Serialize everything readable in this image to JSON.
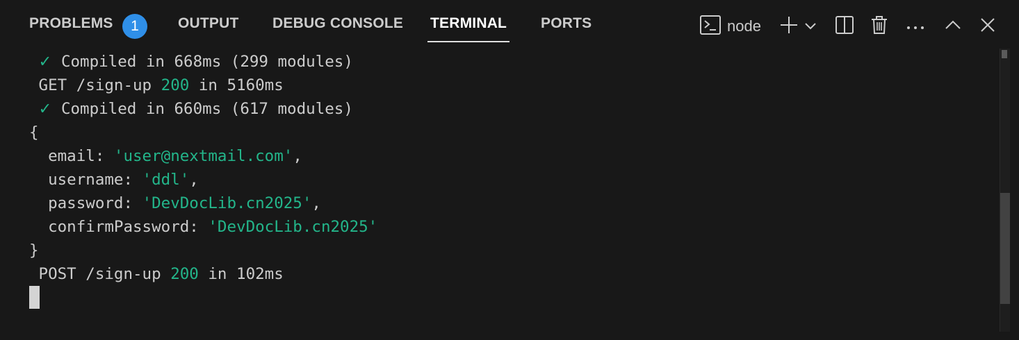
{
  "tabs": [
    {
      "label": "PROBLEMS",
      "badge": "1"
    },
    {
      "label": "OUTPUT"
    },
    {
      "label": "DEBUG CONSOLE"
    },
    {
      "label": "TERMINAL"
    },
    {
      "label": "PORTS"
    }
  ],
  "active_tab": "TERMINAL",
  "toolbar": {
    "terminal_name": "node",
    "icons": [
      "terminal-icon",
      "plus-icon",
      "chevron-down-icon",
      "split-editor-icon",
      "trash-icon",
      "more-icon",
      "chevron-up-icon",
      "close-icon"
    ]
  },
  "terminal": {
    "line1": {
      "check": "✓",
      "text": " Compiled in 668ms (299 modules)"
    },
    "line2": {
      "pre": " GET /sign-up ",
      "status": "200",
      "post": " in 5160ms"
    },
    "line3": {
      "check": "✓",
      "text": " Compiled in 660ms (617 modules)"
    },
    "line4": "{",
    "line5": {
      "key": "  email: ",
      "value": "'user@nextmail.com'",
      "post": ","
    },
    "line6": {
      "key": "  username: ",
      "value": "'ddl'",
      "post": ","
    },
    "line7": {
      "key": "  password: ",
      "value": "'DevDocLib.cn2025'",
      "post": ","
    },
    "line8": {
      "key": "  confirmPassword: ",
      "value": "'DevDocLib.cn2025'",
      "post": ""
    },
    "line9": "}",
    "line10": {
      "pre": " POST /sign-up ",
      "status": "200",
      "post": " in 102ms"
    }
  },
  "colors": {
    "background": "#181818",
    "accent_green": "#23b58a",
    "badge_blue": "#2f8fe8",
    "text": "#cccccc"
  }
}
